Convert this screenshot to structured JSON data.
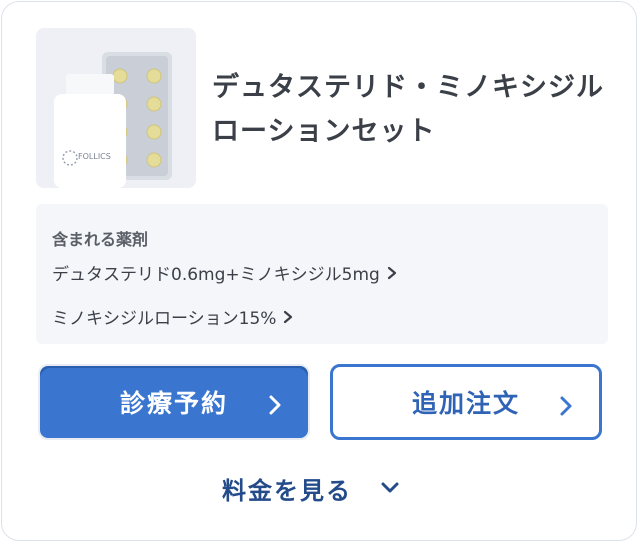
{
  "product": {
    "title": "デュタステリド・ミノキシジルローションセット",
    "logo_text": "FOLLICS"
  },
  "ingredients": {
    "heading": "含まれる薬剤",
    "items": [
      {
        "label": "デュタステリド0.6mg+ミノキシジル5mg"
      },
      {
        "label": "ミノキシジルローション15%"
      }
    ]
  },
  "actions": {
    "reserve_label": "診療予約",
    "order_label": "追加注文",
    "price_label": "料金を見る"
  },
  "colors": {
    "primary": "#3a76d0",
    "primary_text": "#2f63b5",
    "price_text": "#244b8a",
    "panel_bg": "#f4f6fa"
  },
  "icons": {
    "chevron_right": "chevron-right-icon",
    "chevron_down": "chevron-down-icon"
  }
}
